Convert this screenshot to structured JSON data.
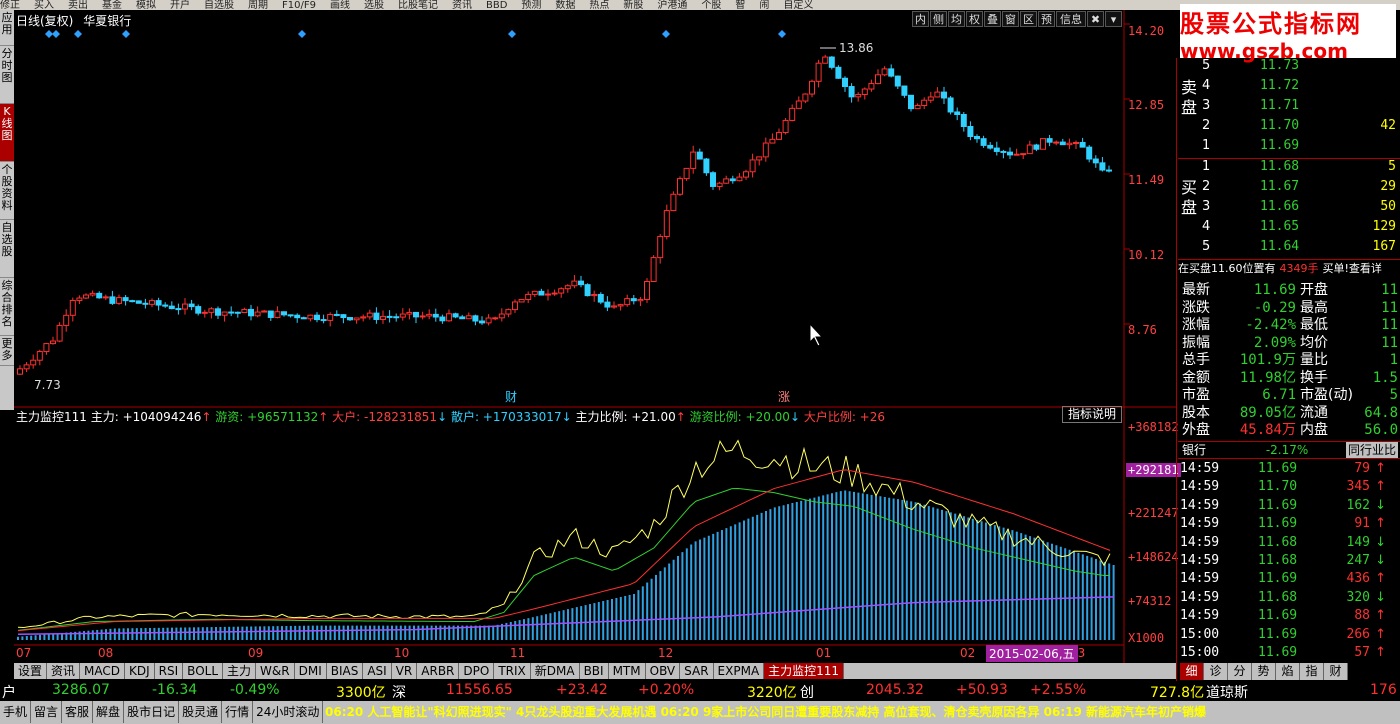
{
  "toolbar": {
    "items": [
      "修正",
      "买入",
      "卖出",
      "基金",
      "模拟",
      "开户",
      "自选股",
      "周期",
      "F10/F9",
      "画线",
      "选股",
      "比股笔记",
      "资讯",
      "BBD",
      "预测",
      "数据",
      "热点",
      "新股",
      "沪港通",
      "个股",
      "智",
      "闹",
      "自定义"
    ]
  },
  "left_nav": [
    "应用",
    "分时图",
    "K线图",
    "个股资料",
    "自选股",
    "综合排名",
    "更多"
  ],
  "chart": {
    "period_label": "日线(复权)",
    "stock_name": "华夏银行",
    "tool_buttons": [
      "内",
      "侧",
      "均",
      "权",
      "叠",
      "窗",
      "区",
      "预",
      "信息"
    ],
    "price_ticks": [
      "14.20",
      "12.85",
      "11.49",
      "10.12",
      "8.76"
    ],
    "high_label": "13.86",
    "low_label": "7.73",
    "markers": [
      "财",
      "涨"
    ],
    "indicator_labels": {
      "name": "主力监控111",
      "main": "主力: +104094246",
      "youzi": "游资: +96571132",
      "dahu": "大户: -128231851",
      "sanhu": "散户: +170333017",
      "main_ratio": "主力比例: +21.00",
      "youzi_ratio": "游资比例: +20.00",
      "dahu_ratio": "大户比例: +26"
    },
    "indicator_help": "指标说明",
    "indicator_ticks": [
      "+368182",
      "+292181",
      "+221247",
      "+148624",
      "+74312",
      "X1000"
    ],
    "date_label": "2015-02-06,五",
    "x_labels": [
      "07",
      "08",
      "09",
      "10",
      "11",
      "12",
      "01",
      "02",
      "03"
    ],
    "tabs": [
      "设置",
      "资讯",
      "MACD",
      "KDJ",
      "RSI",
      "BOLL",
      "主力",
      "W&R",
      "DMI",
      "BIAS",
      "ASI",
      "VR",
      "ARBR",
      "DPO",
      "TRIX",
      "新DMA",
      "BBI",
      "MTM",
      "OBV",
      "SAR",
      "EXPMA",
      "主力监控111"
    ]
  },
  "watermark": {
    "cn": "股票公式指标网",
    "url": "www.gszb.com"
  },
  "orderbook": {
    "sell_label": "卖盘",
    "buy_label": "买盘",
    "sell": [
      {
        "lv": "5",
        "px": "11.73",
        "vol": ""
      },
      {
        "lv": "4",
        "px": "11.72",
        "vol": ""
      },
      {
        "lv": "3",
        "px": "11.71",
        "vol": ""
      },
      {
        "lv": "2",
        "px": "11.70",
        "vol": "42"
      },
      {
        "lv": "1",
        "px": "11.69",
        "vol": ""
      }
    ],
    "buy": [
      {
        "lv": "1",
        "px": "11.68",
        "vol": "5"
      },
      {
        "lv": "2",
        "px": "11.67",
        "vol": "29"
      },
      {
        "lv": "3",
        "px": "11.66",
        "vol": "50"
      },
      {
        "lv": "4",
        "px": "11.65",
        "vol": "129"
      },
      {
        "lv": "5",
        "px": "11.64",
        "vol": "167"
      }
    ],
    "note": "在买盘11.60位置有",
    "note_vol": "4349手",
    "note_link": "买单!查看详"
  },
  "stats": [
    {
      "l": "最新",
      "v": "11.69",
      "l2": "开盘",
      "v2": "11"
    },
    {
      "l": "涨跌",
      "v": "-0.29",
      "l2": "最高",
      "v2": "11"
    },
    {
      "l": "涨幅",
      "v": "-2.42%",
      "l2": "最低",
      "v2": "11"
    },
    {
      "l": "振幅",
      "v": "2.09%",
      "l2": "均价",
      "v2": "11"
    },
    {
      "l": "总手",
      "v": "101.9万",
      "l2": "量比",
      "v2": "1"
    },
    {
      "l": "金额",
      "v": "11.98亿",
      "l2": "换手",
      "v2": "1.5"
    },
    {
      "l": "市盈",
      "v": "6.71",
      "l2": "市盈(动)",
      "v2": "5"
    },
    {
      "l": "股本",
      "v": "89.05亿",
      "l2": "流通",
      "v2": "64.8"
    },
    {
      "l": "外盘",
      "v": "45.84万",
      "l2": "内盘",
      "v2": "56.0"
    }
  ],
  "sector": {
    "name": "银行",
    "change": "-2.17%",
    "link": "同行业比"
  },
  "trades": [
    {
      "t": "14:59",
      "p": "11.69",
      "v": "79",
      "d": "up"
    },
    {
      "t": "14:59",
      "p": "11.70",
      "v": "345",
      "d": "up"
    },
    {
      "t": "14:59",
      "p": "11.69",
      "v": "162",
      "d": "down"
    },
    {
      "t": "14:59",
      "p": "11.69",
      "v": "91",
      "d": "up"
    },
    {
      "t": "14:59",
      "p": "11.68",
      "v": "149",
      "d": "down"
    },
    {
      "t": "14:59",
      "p": "11.68",
      "v": "247",
      "d": "down"
    },
    {
      "t": "14:59",
      "p": "11.69",
      "v": "436",
      "d": "up"
    },
    {
      "t": "14:59",
      "p": "11.68",
      "v": "320",
      "d": "down"
    },
    {
      "t": "14:59",
      "p": "11.69",
      "v": "88",
      "d": "up"
    },
    {
      "t": "15:00",
      "p": "11.69",
      "v": "266",
      "d": "up"
    },
    {
      "t": "15:00",
      "p": "11.69",
      "v": "57",
      "d": "up"
    }
  ],
  "right_tabs": [
    "细",
    "诊",
    "分",
    "势",
    "焰",
    "指",
    "财"
  ],
  "market": {
    "prefix": "户",
    "sh": {
      "v": "3286.07",
      "chg": "-16.34",
      "pct": "-0.49%",
      "amt": "3300亿",
      "name": "深"
    },
    "sz": {
      "v": "11556.65",
      "chg": "+23.42",
      "pct": "+0.20%",
      "amt": "3220亿",
      "name": "创"
    },
    "cy": {
      "v": "2045.32",
      "chg": "+50.93",
      "pct": "+2.55%",
      "amt": "727.8亿",
      "name": "道琼斯"
    },
    "dj": {
      "v": "176"
    }
  },
  "footer": {
    "buttons": [
      "手机",
      "留言",
      "客服",
      "解盘",
      "股市日记",
      "股灵通",
      "行情",
      "24小时滚动"
    ],
    "news": "06:20 人工智能让\"科幻照进现实\"  4只龙头股迎重大发展机遇     06:20 9家上市公司同日遭重要股东减持 高位套现、清仓卖壳原因各异     06:19 新能源汽车年初产销爆"
  },
  "colors": {
    "up": "#ff3030",
    "down": "#30d0ff",
    "green": "#30d030",
    "bg": "#000000"
  }
}
